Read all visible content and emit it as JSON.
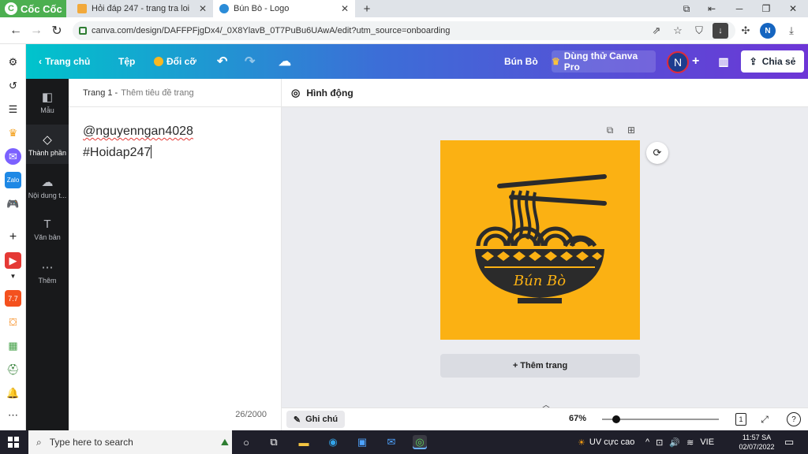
{
  "colors": {
    "brand_green": "#4caf50",
    "canva_gradient_start": "#00c4cc",
    "canva_gradient_end": "#6d35d6",
    "design_background": "#fbb113",
    "design_ink": "#2b2b2b"
  },
  "browser": {
    "brand_label": "Cốc Cốc",
    "tabs": [
      {
        "label": "Hỏi đáp 247 - trang tra loi",
        "icon": "hoidap-favicon",
        "active": false
      },
      {
        "label": "Bún Bò - Logo",
        "icon": "canva-favicon",
        "active": true
      }
    ],
    "new_tab_label": "+",
    "url": "canva.com/design/DAFFPFjgDx4/_0X8YlavB_0T7PuBu6UAwA/edit?utm_source=onboarding",
    "profile_initial": "N"
  },
  "canva": {
    "header": {
      "home_label": "Trang chủ",
      "file_label": "Tệp",
      "resize_label": "Đổi cỡ",
      "design_title": "Bún Bò",
      "try_pro_label": "Dùng thử Canva Pro",
      "avatar_initial": "N",
      "add_label": "+",
      "share_label": "Chia sẻ"
    },
    "rail": [
      {
        "label": "Mẫu",
        "icon": "template-icon"
      },
      {
        "label": "Thành phần",
        "icon": "elements-icon"
      },
      {
        "label": "Nội dung t...",
        "icon": "upload-icon"
      },
      {
        "label": "Văn bản",
        "icon": "text-icon"
      },
      {
        "label": "Thêm",
        "icon": "more-icon"
      }
    ],
    "notes": {
      "page_label": "Trang 1 -",
      "page_title_placeholder": "Thêm tiêu đề trang",
      "line1": "@nguyenngan4028",
      "line2": "#Hoidap247",
      "counter": "26/2000"
    },
    "canvas": {
      "animate_label": "Hình động",
      "logo_text": "Bún Bò",
      "add_page_label": "+ Thêm trang"
    },
    "bottom": {
      "notes_label": "Ghi chú",
      "zoom": "67%",
      "zoom_fraction": 0.12,
      "page_count": "1"
    }
  },
  "taskbar": {
    "search_placeholder": "Type here to search",
    "weather_label": "UV cực cao",
    "language": "VIE",
    "time": "11:57 SA",
    "date": "02/07/2022"
  }
}
